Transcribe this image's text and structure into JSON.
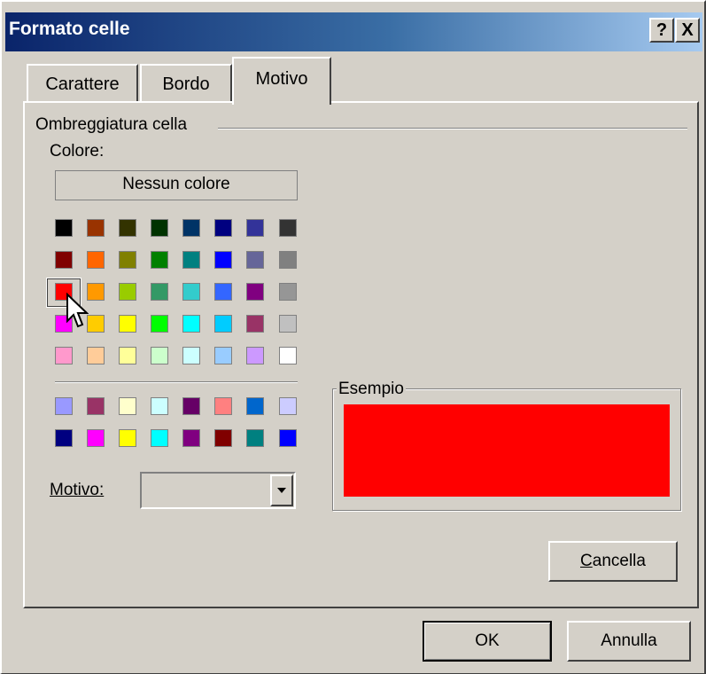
{
  "window": {
    "title": "Formato celle",
    "help_btn": "?",
    "close_btn": "X"
  },
  "tabs": [
    {
      "label": "Carattere",
      "active": false
    },
    {
      "label": "Bordo",
      "active": false
    },
    {
      "label": "Motivo",
      "active": true
    }
  ],
  "shading": {
    "group_title": "Ombreggiatura cella",
    "color_label": "Colore:",
    "no_color": "Nessun colore",
    "selected_color": "#ff0000",
    "palette_main": [
      [
        "#000000",
        "#993300",
        "#333300",
        "#003300",
        "#003366",
        "#000080",
        "#333399",
        "#333333"
      ],
      [
        "#800000",
        "#ff6600",
        "#808000",
        "#008000",
        "#008080",
        "#0000ff",
        "#666699",
        "#808080"
      ],
      [
        "#ff0000",
        "#ff9900",
        "#99cc00",
        "#339966",
        "#33cccc",
        "#3366ff",
        "#800080",
        "#969696"
      ],
      [
        "#ff00ff",
        "#ffcc00",
        "#ffff00",
        "#00ff00",
        "#00ffff",
        "#00ccff",
        "#993366",
        "#c0c0c0"
      ],
      [
        "#ff99cc",
        "#ffcc99",
        "#ffff99",
        "#ccffcc",
        "#ccffff",
        "#99ccff",
        "#cc99ff",
        "#ffffff"
      ]
    ],
    "palette_extra": [
      [
        "#9999ff",
        "#993366",
        "#ffffcc",
        "#ccffff",
        "#660066",
        "#ff8080",
        "#0066cc",
        "#ccccff"
      ],
      [
        "#000080",
        "#ff00ff",
        "#ffff00",
        "#00ffff",
        "#800080",
        "#800000",
        "#008080",
        "#0000ff"
      ]
    ],
    "pattern_label": "Motivo:",
    "pattern_value": ""
  },
  "sample": {
    "label": "Esempio",
    "color": "#ff0000"
  },
  "buttons": {
    "clear": "Cancella",
    "ok": "OK",
    "cancel": "Annulla"
  }
}
